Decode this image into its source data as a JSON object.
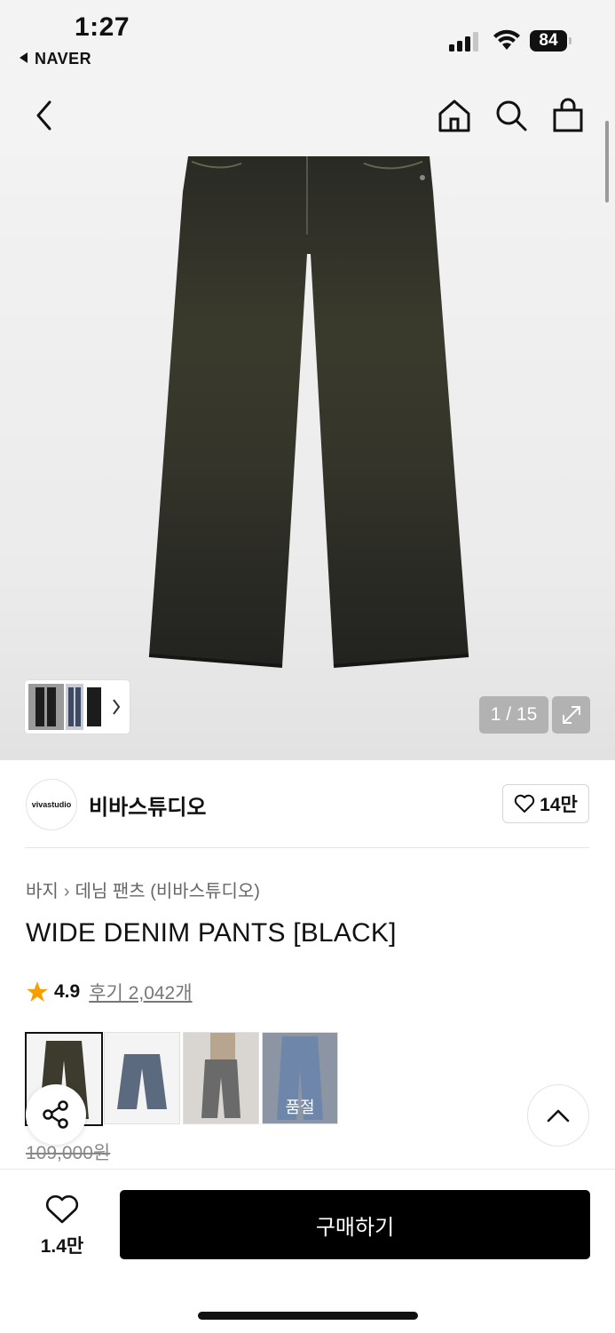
{
  "status_bar": {
    "time": "1:27",
    "back_app": "NAVER",
    "battery": "84"
  },
  "header": {
    "back_icon": "chevron-left-icon",
    "home_icon": "home-icon",
    "search_icon": "search-icon",
    "bag_icon": "shopping-bag-icon"
  },
  "gallery": {
    "counter": "1 / 15",
    "expand_icon": "expand-icon"
  },
  "brand": {
    "logo_text": "vivastudio",
    "name": "비바스튜디오",
    "likes": "14만"
  },
  "product": {
    "breadcrumb": [
      "바지",
      "데님 팬츠 (비바스튜디오)"
    ],
    "title": "WIDE DENIM PANTS [BLACK]",
    "rating": "4.9",
    "reviews": "후기 2,042개",
    "original_price": "109,000원",
    "variants": [
      {
        "color": "#3d3b2e",
        "selected": true,
        "sold_out": ""
      },
      {
        "color": "#5b6a7e",
        "selected": false,
        "sold_out": ""
      },
      {
        "color": "#6a6a6a",
        "selected": false,
        "sold_out": ""
      },
      {
        "color": "#6d86aa",
        "selected": false,
        "sold_out": "품절"
      }
    ]
  },
  "bottom": {
    "wish_count": "1.4만",
    "buy_label": "구매하기"
  }
}
